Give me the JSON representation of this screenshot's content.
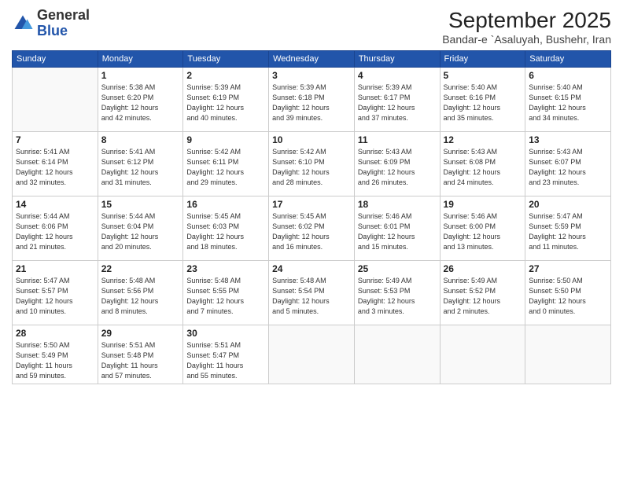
{
  "logo": {
    "general": "General",
    "blue": "Blue"
  },
  "header": {
    "month": "September 2025",
    "location": "Bandar-e `Asaluyah, Bushehr, Iran"
  },
  "weekdays": [
    "Sunday",
    "Monday",
    "Tuesday",
    "Wednesday",
    "Thursday",
    "Friday",
    "Saturday"
  ],
  "weeks": [
    [
      {
        "day": "",
        "info": ""
      },
      {
        "day": "1",
        "info": "Sunrise: 5:38 AM\nSunset: 6:20 PM\nDaylight: 12 hours\nand 42 minutes."
      },
      {
        "day": "2",
        "info": "Sunrise: 5:39 AM\nSunset: 6:19 PM\nDaylight: 12 hours\nand 40 minutes."
      },
      {
        "day": "3",
        "info": "Sunrise: 5:39 AM\nSunset: 6:18 PM\nDaylight: 12 hours\nand 39 minutes."
      },
      {
        "day": "4",
        "info": "Sunrise: 5:39 AM\nSunset: 6:17 PM\nDaylight: 12 hours\nand 37 minutes."
      },
      {
        "day": "5",
        "info": "Sunrise: 5:40 AM\nSunset: 6:16 PM\nDaylight: 12 hours\nand 35 minutes."
      },
      {
        "day": "6",
        "info": "Sunrise: 5:40 AM\nSunset: 6:15 PM\nDaylight: 12 hours\nand 34 minutes."
      }
    ],
    [
      {
        "day": "7",
        "info": "Sunrise: 5:41 AM\nSunset: 6:14 PM\nDaylight: 12 hours\nand 32 minutes."
      },
      {
        "day": "8",
        "info": "Sunrise: 5:41 AM\nSunset: 6:12 PM\nDaylight: 12 hours\nand 31 minutes."
      },
      {
        "day": "9",
        "info": "Sunrise: 5:42 AM\nSunset: 6:11 PM\nDaylight: 12 hours\nand 29 minutes."
      },
      {
        "day": "10",
        "info": "Sunrise: 5:42 AM\nSunset: 6:10 PM\nDaylight: 12 hours\nand 28 minutes."
      },
      {
        "day": "11",
        "info": "Sunrise: 5:43 AM\nSunset: 6:09 PM\nDaylight: 12 hours\nand 26 minutes."
      },
      {
        "day": "12",
        "info": "Sunrise: 5:43 AM\nSunset: 6:08 PM\nDaylight: 12 hours\nand 24 minutes."
      },
      {
        "day": "13",
        "info": "Sunrise: 5:43 AM\nSunset: 6:07 PM\nDaylight: 12 hours\nand 23 minutes."
      }
    ],
    [
      {
        "day": "14",
        "info": "Sunrise: 5:44 AM\nSunset: 6:06 PM\nDaylight: 12 hours\nand 21 minutes."
      },
      {
        "day": "15",
        "info": "Sunrise: 5:44 AM\nSunset: 6:04 PM\nDaylight: 12 hours\nand 20 minutes."
      },
      {
        "day": "16",
        "info": "Sunrise: 5:45 AM\nSunset: 6:03 PM\nDaylight: 12 hours\nand 18 minutes."
      },
      {
        "day": "17",
        "info": "Sunrise: 5:45 AM\nSunset: 6:02 PM\nDaylight: 12 hours\nand 16 minutes."
      },
      {
        "day": "18",
        "info": "Sunrise: 5:46 AM\nSunset: 6:01 PM\nDaylight: 12 hours\nand 15 minutes."
      },
      {
        "day": "19",
        "info": "Sunrise: 5:46 AM\nSunset: 6:00 PM\nDaylight: 12 hours\nand 13 minutes."
      },
      {
        "day": "20",
        "info": "Sunrise: 5:47 AM\nSunset: 5:59 PM\nDaylight: 12 hours\nand 11 minutes."
      }
    ],
    [
      {
        "day": "21",
        "info": "Sunrise: 5:47 AM\nSunset: 5:57 PM\nDaylight: 12 hours\nand 10 minutes."
      },
      {
        "day": "22",
        "info": "Sunrise: 5:48 AM\nSunset: 5:56 PM\nDaylight: 12 hours\nand 8 minutes."
      },
      {
        "day": "23",
        "info": "Sunrise: 5:48 AM\nSunset: 5:55 PM\nDaylight: 12 hours\nand 7 minutes."
      },
      {
        "day": "24",
        "info": "Sunrise: 5:48 AM\nSunset: 5:54 PM\nDaylight: 12 hours\nand 5 minutes."
      },
      {
        "day": "25",
        "info": "Sunrise: 5:49 AM\nSunset: 5:53 PM\nDaylight: 12 hours\nand 3 minutes."
      },
      {
        "day": "26",
        "info": "Sunrise: 5:49 AM\nSunset: 5:52 PM\nDaylight: 12 hours\nand 2 minutes."
      },
      {
        "day": "27",
        "info": "Sunrise: 5:50 AM\nSunset: 5:50 PM\nDaylight: 12 hours\nand 0 minutes."
      }
    ],
    [
      {
        "day": "28",
        "info": "Sunrise: 5:50 AM\nSunset: 5:49 PM\nDaylight: 11 hours\nand 59 minutes."
      },
      {
        "day": "29",
        "info": "Sunrise: 5:51 AM\nSunset: 5:48 PM\nDaylight: 11 hours\nand 57 minutes."
      },
      {
        "day": "30",
        "info": "Sunrise: 5:51 AM\nSunset: 5:47 PM\nDaylight: 11 hours\nand 55 minutes."
      },
      {
        "day": "",
        "info": ""
      },
      {
        "day": "",
        "info": ""
      },
      {
        "day": "",
        "info": ""
      },
      {
        "day": "",
        "info": ""
      }
    ]
  ]
}
